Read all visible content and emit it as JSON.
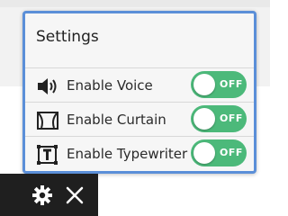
{
  "settings": {
    "title": "Settings",
    "items": [
      {
        "label": "Enable Voice",
        "icon": "speaker-icon",
        "toggle_state": "OFF"
      },
      {
        "label": "Enable Curtain",
        "icon": "curtain-icon",
        "toggle_state": "OFF"
      },
      {
        "label": "Enable Typewriter",
        "icon": "typewriter-icon",
        "toggle_state": "OFF"
      }
    ]
  },
  "toolbar": {
    "buttons": [
      {
        "icon": "gear-icon"
      },
      {
        "icon": "close-icon"
      }
    ]
  },
  "colors": {
    "accent_border": "#5b8fd8",
    "toggle_green": "#4cb97a",
    "toolbar_bg": "#1f1f1f"
  }
}
